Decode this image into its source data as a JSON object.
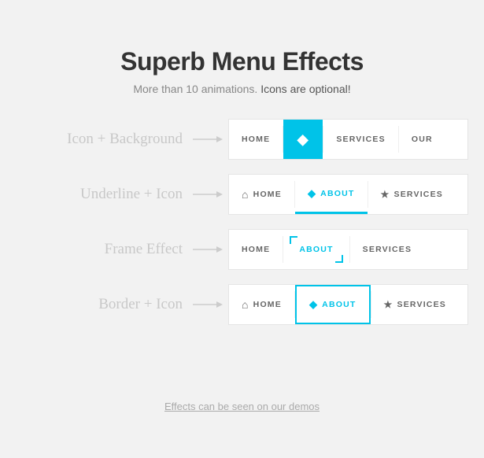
{
  "header": {
    "title": "Superb Menu Effects",
    "subtitle_plain": "More than 10 animations. ",
    "subtitle_emphasis": "Icons are optional!"
  },
  "effects": [
    {
      "label": "Icon + Background",
      "id": "effect-1",
      "items": [
        {
          "text": "HOME",
          "icon": "",
          "state": "normal"
        },
        {
          "text": "",
          "icon": "◆",
          "state": "active"
        },
        {
          "text": "SERVICES",
          "icon": "",
          "state": "normal"
        },
        {
          "text": "OUR",
          "icon": "",
          "state": "normal"
        }
      ]
    },
    {
      "label": "Underline + Icon",
      "id": "effect-2",
      "items": [
        {
          "text": "HOME",
          "icon": "⌂",
          "state": "normal"
        },
        {
          "text": "ABOUT",
          "icon": "◆",
          "state": "active"
        },
        {
          "text": "SERVICES",
          "icon": "★",
          "state": "normal"
        }
      ]
    },
    {
      "label": "Frame Effect",
      "id": "effect-3",
      "items": [
        {
          "text": "HOME",
          "icon": "",
          "state": "normal"
        },
        {
          "text": "ABOUT",
          "icon": "",
          "state": "active"
        },
        {
          "text": "SERVICES",
          "icon": "",
          "state": "normal"
        }
      ]
    },
    {
      "label": "Border + Icon",
      "id": "effect-4",
      "items": [
        {
          "text": "HOME",
          "icon": "⌂",
          "state": "normal"
        },
        {
          "text": "ABOUT",
          "icon": "◆",
          "state": "active"
        },
        {
          "text": "SERVICES",
          "icon": "★",
          "state": "normal"
        }
      ]
    }
  ],
  "footer": {
    "link_text": "Effects can be seen on our demos"
  },
  "colors": {
    "accent": "#00c3e8",
    "bg": "#f2f2f2",
    "text_dark": "#333",
    "text_muted": "#aaa"
  }
}
